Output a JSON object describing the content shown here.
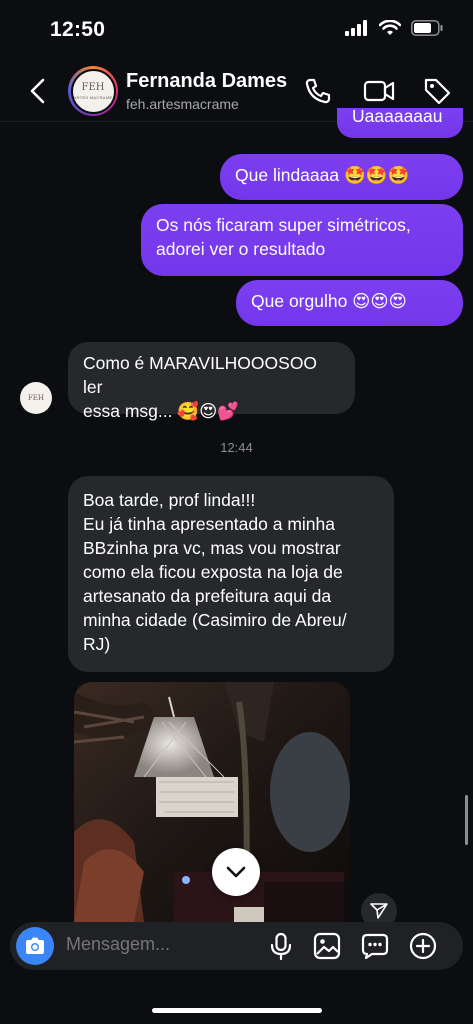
{
  "status_bar": {
    "time": "12:50"
  },
  "header": {
    "name": "Fernanda Dames",
    "username": "feh.artesmacrame",
    "avatar_text": "FEH",
    "avatar_subtext": "ARTES MACRAMÊ"
  },
  "messages": {
    "out_0": "Uaaaaaaau",
    "out_1": "Que lindaaaa 🤩🤩🤩",
    "out_2_line1": "Os nós ficaram super simétricos,",
    "out_2_line2": "adorei ver o resultado",
    "out_3": "Que orgulho 😍😍😍",
    "in_1_line1": "Como é MARAVILHOOOSOO ler",
    "in_1_line2": "essa msg... 🥰😍💕",
    "timestamp": "12:44",
    "in_2_lines": [
      "Boa tarde, prof linda!!!",
      "Eu já tinha apresentado a minha",
      "BBzinha pra vc, mas vou mostrar",
      "como ela ficou exposta na loja de",
      "artesanato da prefeitura aqui da",
      "minha cidade (Casimiro de Abreu/",
      "RJ)"
    ]
  },
  "composer": {
    "placeholder": "Mensagem..."
  },
  "colors": {
    "outgoing": "#7c3aed",
    "incoming": "#26282c",
    "camera": "#3a86f8"
  }
}
